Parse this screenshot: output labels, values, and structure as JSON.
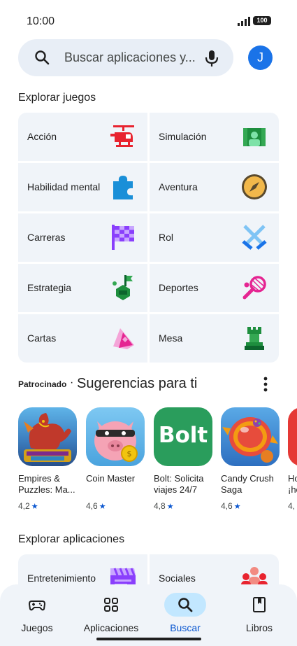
{
  "status": {
    "time": "10:00",
    "battery": "100"
  },
  "search": {
    "placeholder": "Buscar aplicaciones y..."
  },
  "account": {
    "initial": "J"
  },
  "games": {
    "title": "Explorar juegos",
    "categories": [
      {
        "label": "Acción",
        "icon": "helicopter-icon"
      },
      {
        "label": "Simulación",
        "icon": "simulation-icon"
      },
      {
        "label": "Habilidad mental",
        "icon": "puzzle-icon"
      },
      {
        "label": "Aventura",
        "icon": "compass-icon"
      },
      {
        "label": "Carreras",
        "icon": "checkered-flag-icon"
      },
      {
        "label": "Rol",
        "icon": "crossed-swords-icon"
      },
      {
        "label": "Estrategia",
        "icon": "strategy-icon"
      },
      {
        "label": "Deportes",
        "icon": "tennis-racket-icon"
      },
      {
        "label": "Cartas",
        "icon": "cards-icon"
      },
      {
        "label": "Mesa",
        "icon": "chess-rook-icon"
      }
    ]
  },
  "suggestions": {
    "sponsored": "Patrocinado",
    "separator": "·",
    "title": "Sugerencias para ti",
    "apps": [
      {
        "name": "Empires & Puzzles: Ma...",
        "rating": "4,2",
        "icon": "empires-puzzles-icon"
      },
      {
        "name": "Coin Master",
        "rating": "4,6",
        "icon": "coin-master-icon"
      },
      {
        "name": "Bolt: Solicita viajes 24/7",
        "rating": "4,8",
        "icon": "bolt-icon",
        "icon_text": "Bolt"
      },
      {
        "name": "Candy Crush Saga",
        "rating": "4,6",
        "icon": "candy-crush-icon"
      },
      {
        "name": "Ho ¡he",
        "rating": "4,",
        "icon": "partial-app-icon"
      }
    ]
  },
  "apps_section": {
    "title": "Explorar aplicaciones",
    "categories": [
      {
        "label": "Entretenimiento",
        "icon": "clapperboard-icon"
      },
      {
        "label": "Sociales",
        "icon": "people-icon"
      }
    ]
  },
  "nav": [
    {
      "label": "Juegos",
      "icon": "gamepad-icon",
      "active": false
    },
    {
      "label": "Aplicaciones",
      "icon": "apps-grid-icon",
      "active": false
    },
    {
      "label": "Buscar",
      "icon": "search-icon",
      "active": true
    },
    {
      "label": "Libros",
      "icon": "book-icon",
      "active": false
    }
  ],
  "colors": {
    "accent": "#0b57d0",
    "search_bg": "#e8eef6",
    "card_bg": "#f0f4f9",
    "nav_active": "#c2e7ff",
    "avatar": "#1a73e8"
  }
}
